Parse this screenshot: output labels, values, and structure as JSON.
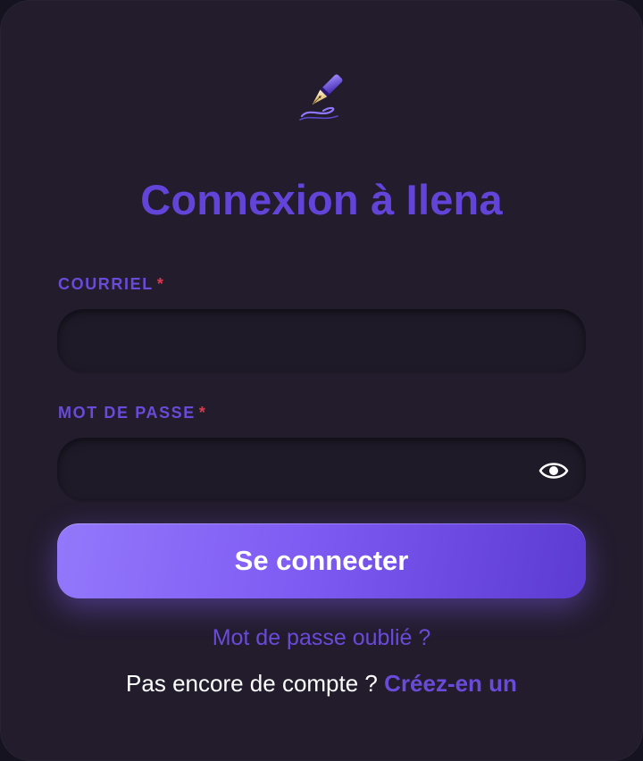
{
  "logo": {
    "icon": "fountain-pen-icon"
  },
  "title": "Connexion à Ilena",
  "email": {
    "label": "COURRIEL",
    "required_mark": "*",
    "value": "",
    "placeholder": ""
  },
  "password": {
    "label": "MOT DE PASSE",
    "required_mark": "*",
    "value": "",
    "placeholder": "",
    "toggle_icon": "eye-icon"
  },
  "submit_label": "Se connecter",
  "forgot_label": "Mot de passe oublié ?",
  "signup": {
    "prompt": "Pas encore de compte ?",
    "link_label": "Créez-en un"
  },
  "colors": {
    "accent": "#6244d8",
    "required": "#e0384b",
    "background": "#221c2d"
  }
}
